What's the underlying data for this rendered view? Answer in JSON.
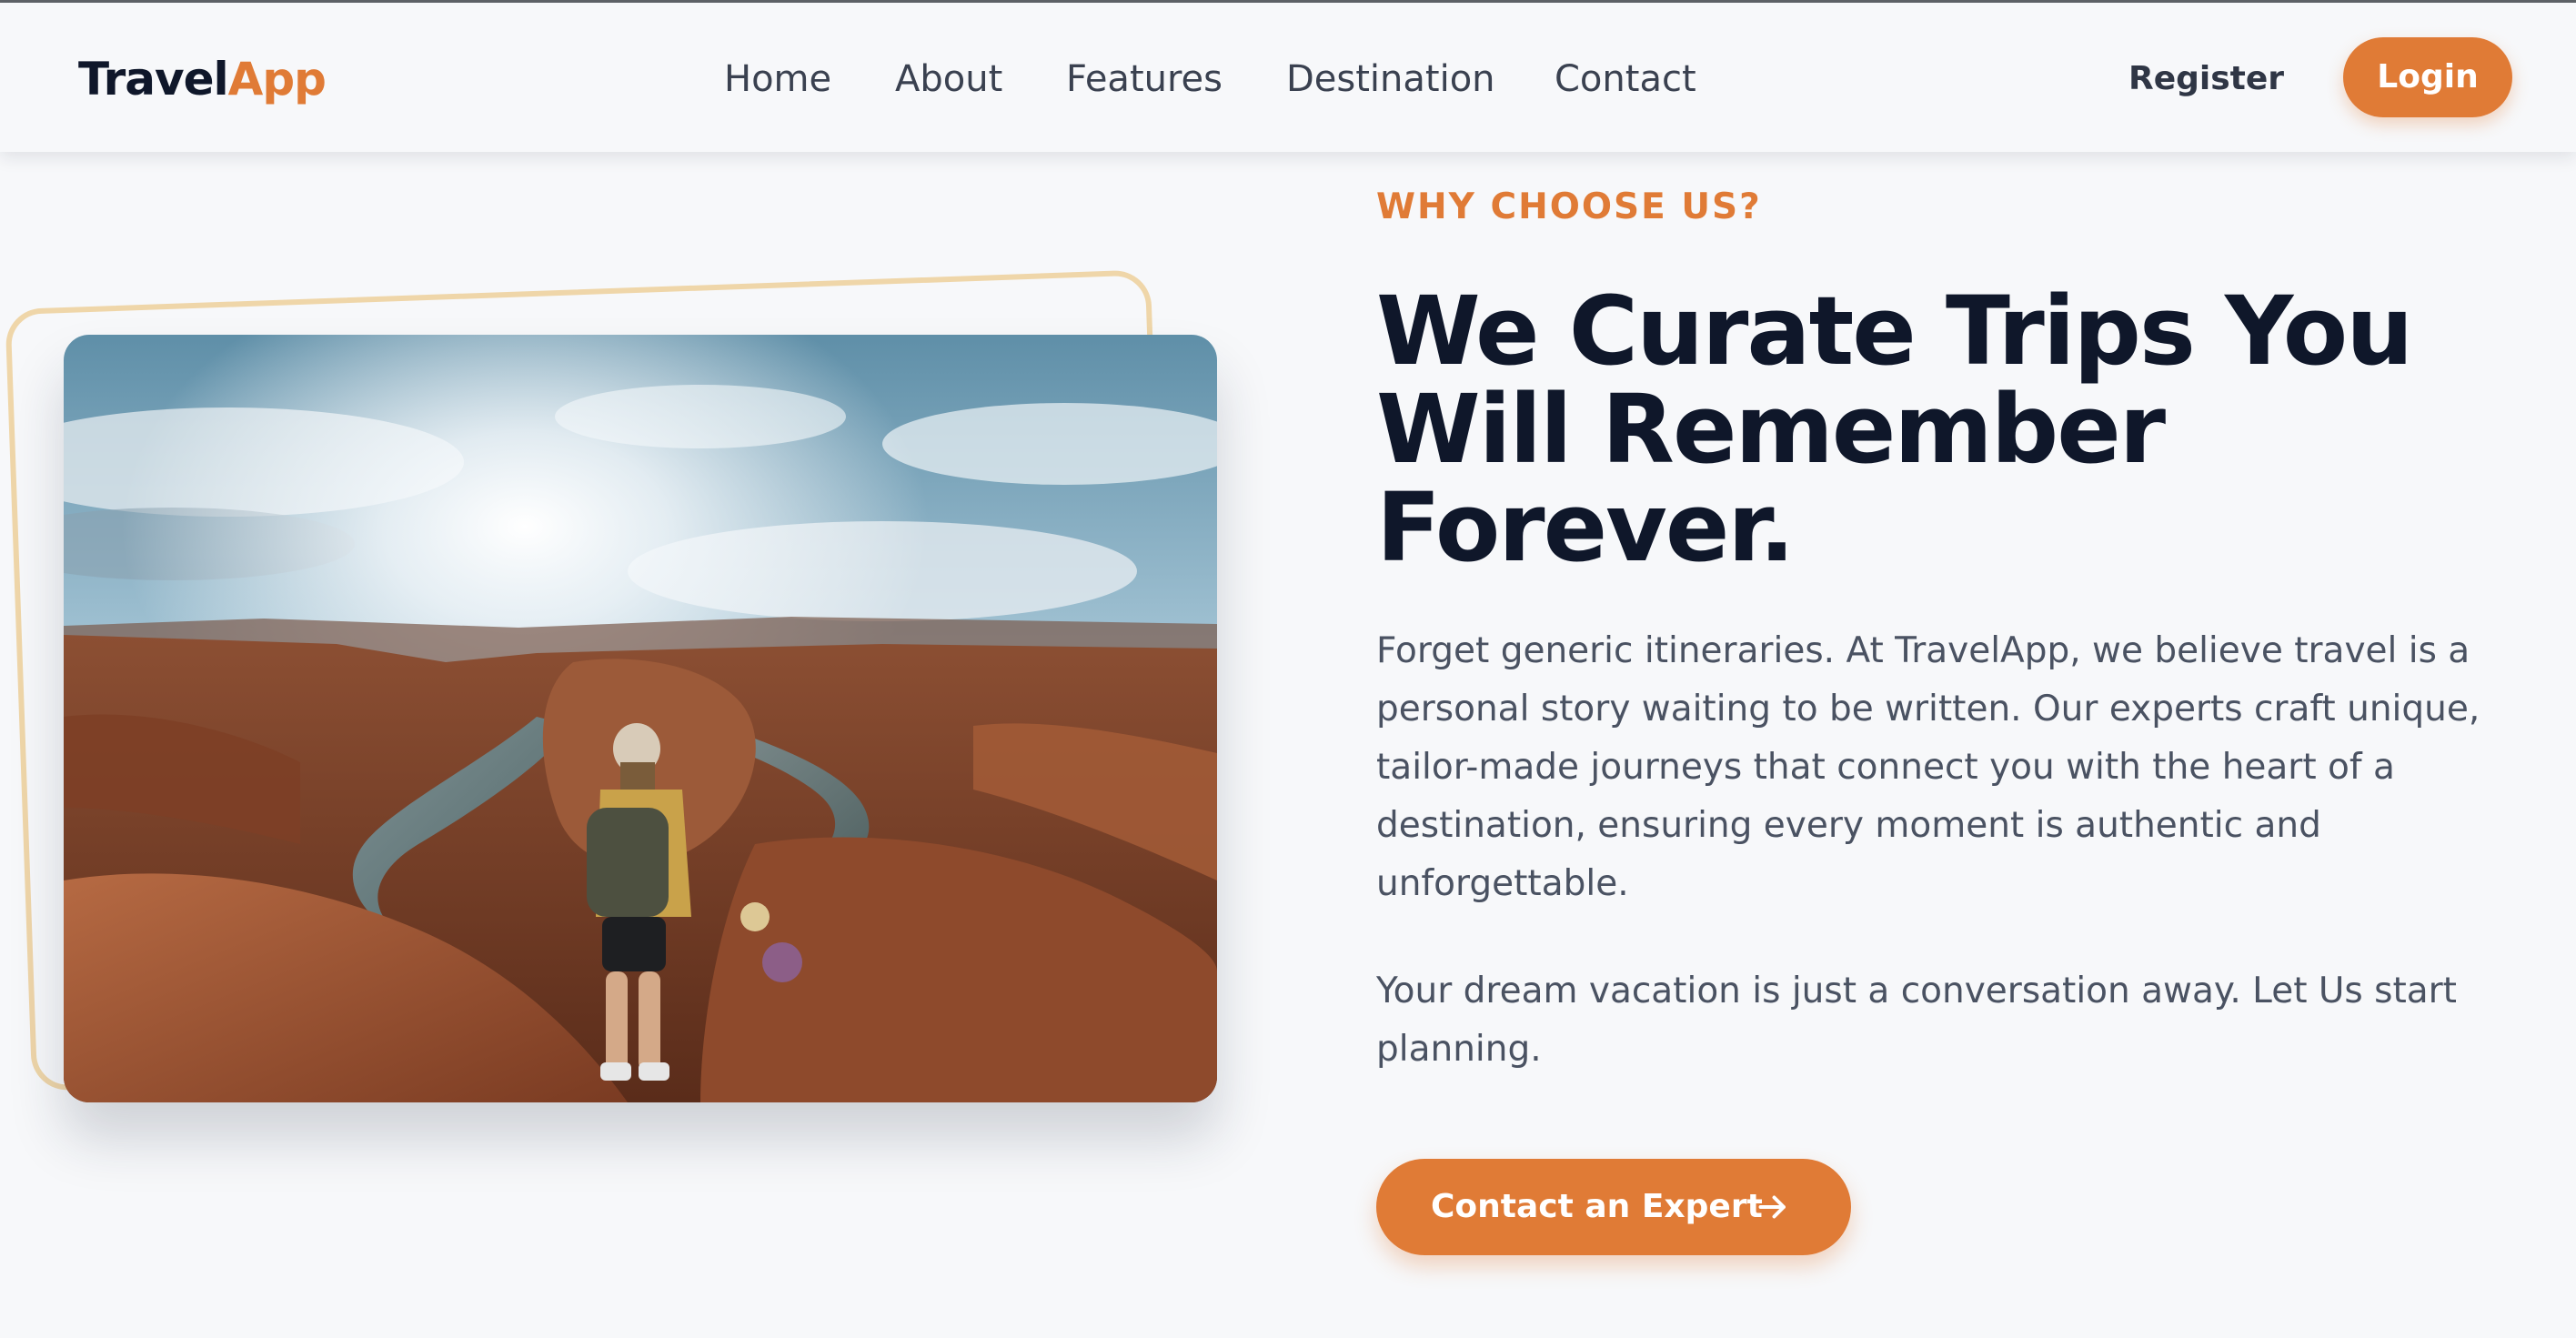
{
  "header": {
    "logo": {
      "part1": "Travel",
      "part2": "App"
    },
    "nav": [
      "Home",
      "About",
      "Features",
      "Destination",
      "Contact"
    ],
    "register_label": "Register",
    "login_label": "Login"
  },
  "hero": {
    "eyebrow": "WHY CHOOSE US?",
    "headline": "We Curate Trips You Will Remember Forever.",
    "paragraph1": "Forget generic itineraries. At TravelApp, we believe travel is a personal story waiting to be written. Our experts craft unique, tailor-made journeys that connect you with the heart of a destination, ensuring every moment is authentic and unforgettable.",
    "paragraph2": "Your dream vacation is just a conversation away. Let Us start planning.",
    "cta_label": "Contact an Expert",
    "cta_icon": "arrow-right-icon"
  },
  "colors": {
    "accent": "#e07b36",
    "heading": "#0f172a",
    "body_text": "#4a5262",
    "background": "#f7f8fa",
    "frame": "#efd6a9"
  }
}
